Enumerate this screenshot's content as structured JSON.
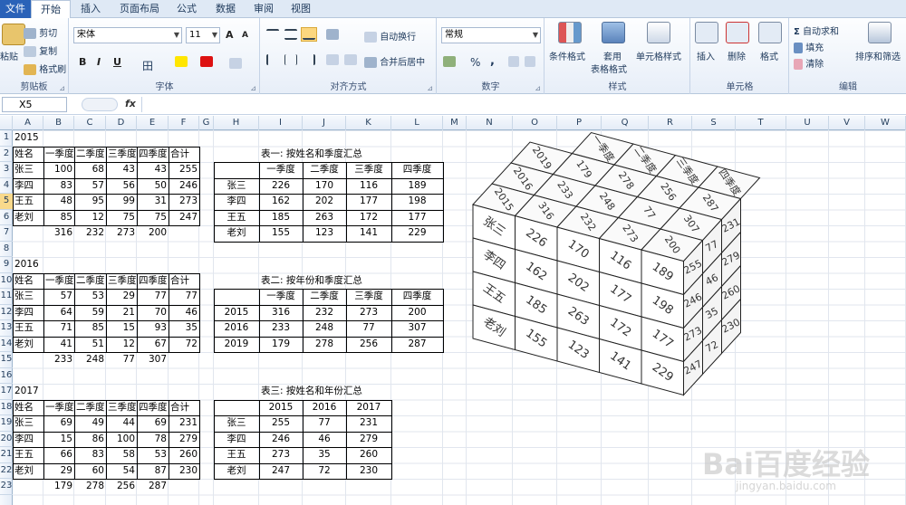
{
  "tabs": [
    {
      "label": "文件",
      "state": "file"
    },
    {
      "label": "开始",
      "state": "active"
    },
    {
      "label": "插入",
      "state": ""
    },
    {
      "label": "页面布局",
      "state": ""
    },
    {
      "label": "公式",
      "state": ""
    },
    {
      "label": "数据",
      "state": ""
    },
    {
      "label": "审阅",
      "state": ""
    },
    {
      "label": "视图",
      "state": ""
    }
  ],
  "ribbon": {
    "clipboard": {
      "paste": "粘贴",
      "cut": "剪切",
      "copy": "复制",
      "format_painter": "格式刷",
      "label": "剪贴板"
    },
    "font": {
      "name": "宋体",
      "size": "11",
      "grow": "A",
      "shrink": "A",
      "bold": "B",
      "italic": "I",
      "underline": "U",
      "label": "字体"
    },
    "alignment": {
      "wrap": "自动换行",
      "merge": "合并后居中",
      "label": "对齐方式"
    },
    "number": {
      "format": "常规",
      "percent": "%",
      "comma": ",",
      "label": "数字"
    },
    "styles": {
      "conditional": "条件格式",
      "table_fmt": "套用",
      "table_fmt2": "表格格式",
      "cell_styles": "单元格样式",
      "label": "样式"
    },
    "cells": {
      "insert": "插入",
      "delete": "删除",
      "format": "格式",
      "label": "单元格"
    },
    "editing": {
      "autosum": "自动求和",
      "fill": "填充",
      "clear": "清除",
      "sort_filter": "排序和筛选",
      "label": "编辑"
    }
  },
  "formula_bar": {
    "name_box": "X5",
    "fx": "fx",
    "formula": ""
  },
  "columns": [
    "A",
    "B",
    "C",
    "D",
    "E",
    "F",
    "G",
    "H",
    "I",
    "J",
    "K",
    "L",
    "M",
    "N",
    "O",
    "P",
    "Q",
    "R",
    "S",
    "T",
    "U",
    "V",
    "W"
  ],
  "rows": [
    "1",
    "2",
    "3",
    "4",
    "5",
    "6",
    "7",
    "8",
    "9",
    "10",
    "11",
    "12",
    "13",
    "14",
    "15",
    "16",
    "17",
    "18",
    "19",
    "20",
    "21",
    "22",
    "23"
  ],
  "selected_row": "5",
  "blocks": [
    {
      "year": "2015",
      "header": [
        "姓名",
        "一季度",
        "二季度",
        "三季度",
        "四季度",
        "合计"
      ],
      "rows": [
        [
          "张三",
          "100",
          "68",
          "43",
          "43",
          "255"
        ],
        [
          "李四",
          "83",
          "57",
          "56",
          "50",
          "246"
        ],
        [
          "王五",
          "48",
          "95",
          "99",
          "31",
          "273"
        ],
        [
          "老刘",
          "85",
          "12",
          "75",
          "75",
          "247"
        ]
      ],
      "totals": [
        "",
        "316",
        "232",
        "273",
        "200",
        ""
      ]
    },
    {
      "year": "2016",
      "header": [
        "姓名",
        "一季度",
        "二季度",
        "三季度",
        "四季度",
        "合计"
      ],
      "rows": [
        [
          "张三",
          "57",
          "53",
          "29",
          "77",
          "77"
        ],
        [
          "李四",
          "64",
          "59",
          "21",
          "70",
          "46"
        ],
        [
          "王五",
          "71",
          "85",
          "15",
          "93",
          "35"
        ],
        [
          "老刘",
          "41",
          "51",
          "12",
          "67",
          "72"
        ]
      ],
      "totals": [
        "",
        "233",
        "248",
        "77",
        "307",
        ""
      ]
    },
    {
      "year": "2017",
      "header": [
        "姓名",
        "一季度",
        "二季度",
        "三季度",
        "四季度",
        "合计"
      ],
      "rows": [
        [
          "张三",
          "69",
          "49",
          "44",
          "69",
          "231"
        ],
        [
          "李四",
          "15",
          "86",
          "100",
          "78",
          "279"
        ],
        [
          "王五",
          "66",
          "83",
          "58",
          "53",
          "260"
        ],
        [
          "老刘",
          "29",
          "60",
          "54",
          "87",
          "230"
        ]
      ],
      "totals": [
        "",
        "179",
        "278",
        "256",
        "287",
        ""
      ]
    }
  ],
  "summary1": {
    "title": "表一: 按姓名和季度汇总",
    "header": [
      "",
      "一季度",
      "二季度",
      "三季度",
      "四季度"
    ],
    "rows": [
      [
        "张三",
        "226",
        "170",
        "116",
        "189"
      ],
      [
        "李四",
        "162",
        "202",
        "177",
        "198"
      ],
      [
        "王五",
        "185",
        "263",
        "172",
        "177"
      ],
      [
        "老刘",
        "155",
        "123",
        "141",
        "229"
      ]
    ]
  },
  "summary2": {
    "title": "表二: 按年份和季度汇总",
    "header": [
      "",
      "一季度",
      "二季度",
      "三季度",
      "四季度"
    ],
    "rows": [
      [
        "2015",
        "316",
        "232",
        "273",
        "200"
      ],
      [
        "2016",
        "233",
        "248",
        "77",
        "307"
      ],
      [
        "2019",
        "179",
        "278",
        "256",
        "287"
      ]
    ]
  },
  "summary3": {
    "title": "表三: 按姓名和年份汇总",
    "header": [
      "",
      "2015",
      "2016",
      "2017"
    ],
    "rows": [
      [
        "张三",
        "255",
        "77",
        "231"
      ],
      [
        "李四",
        "246",
        "46",
        "279"
      ],
      [
        "王五",
        "273",
        "35",
        "260"
      ],
      [
        "老刘",
        "247",
        "72",
        "230"
      ]
    ]
  },
  "cube": {
    "top_years": [
      "2015",
      "2016",
      "2019"
    ],
    "top_quarters": [
      "一季度",
      "二季度",
      "三季度",
      "四季度"
    ],
    "top_values": [
      [
        "316",
        "232",
        "273",
        "200"
      ],
      [
        "233",
        "248",
        "77",
        "307"
      ],
      [
        "179",
        "278",
        "256",
        "287"
      ]
    ],
    "front_names": [
      "张三",
      "李四",
      "王五",
      "老刘"
    ],
    "front_values": [
      [
        "226",
        "170",
        "116",
        "189"
      ],
      [
        "162",
        "202",
        "177",
        "198"
      ],
      [
        "185",
        "263",
        "172",
        "177"
      ],
      [
        "155",
        "123",
        "141",
        "229"
      ]
    ],
    "side_values": [
      [
        "255",
        "77",
        "231"
      ],
      [
        "246",
        "46",
        "279"
      ],
      [
        "273",
        "35",
        "260"
      ],
      [
        "247",
        "72",
        "230"
      ]
    ]
  },
  "watermark": {
    "logo": "Bai百度经验",
    "url": "jingyan.baidu.com"
  }
}
